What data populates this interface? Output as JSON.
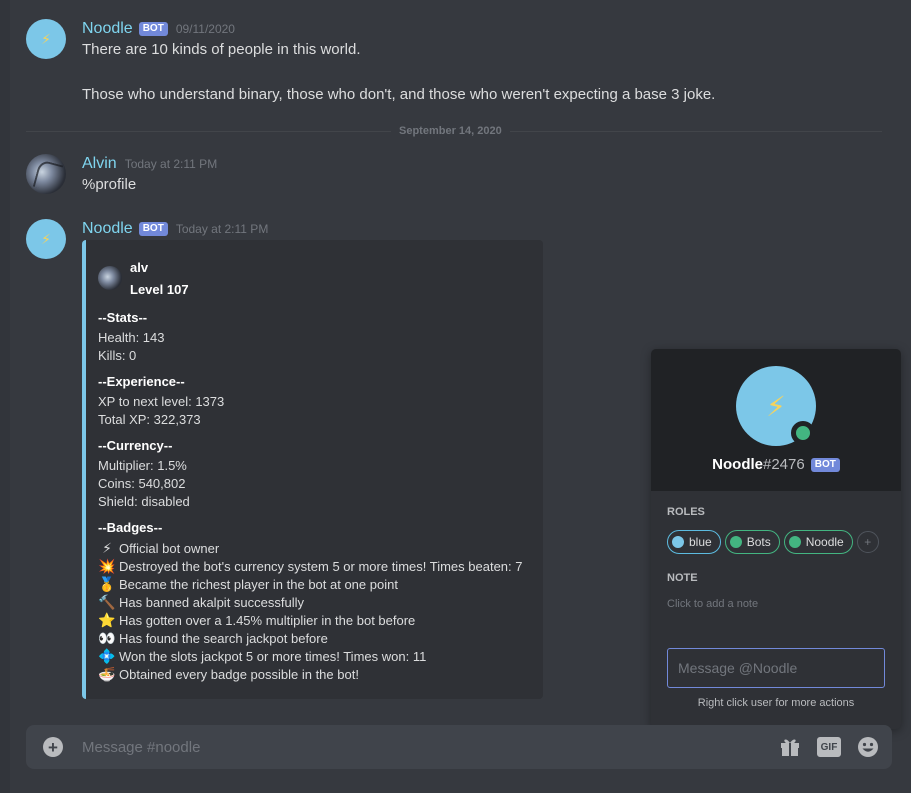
{
  "messages": [
    {
      "author": "Noodle",
      "bot_tag": "BOT",
      "timestamp": "09/11/2020",
      "line1": "There are 10 kinds of people in this world.",
      "line2": "Those who understand binary, those who don't, and those who weren't expecting a base 3 joke."
    },
    {
      "author": "Alvin",
      "timestamp": "Today at 2:11 PM",
      "text": "%profile"
    },
    {
      "author": "Noodle",
      "bot_tag": "BOT",
      "timestamp": "Today at 2:11 PM"
    }
  ],
  "divider": "September 14, 2020",
  "embed": {
    "name": "alv",
    "level": "Level 107",
    "stats_title": "--Stats--",
    "health": "Health: 143",
    "kills": "Kills: 0",
    "experience_title": "--Experience--",
    "xp_next": "XP to next level: 1373",
    "xp_total": "Total XP: 322,373",
    "currency_title": "--Currency--",
    "multiplier": "Multiplier: 1.5%",
    "coins": "Coins: 540,802",
    "shield": "Shield: disabled",
    "badges_title": "--Badges--",
    "badges": [
      {
        "icon": "lightning-icon",
        "glyph": "⚡",
        "text": "Official bot owner"
      },
      {
        "icon": "collision-icon",
        "glyph": "💥",
        "text": "Destroyed the bot's currency system 5 or more times! Times beaten: 7"
      },
      {
        "icon": "medal-icon",
        "glyph": "🥇",
        "text": "Became the richest player in the bot at one point"
      },
      {
        "icon": "hammer-icon",
        "glyph": "🔨",
        "text": "Has banned akalpit successfully"
      },
      {
        "icon": "star-icon",
        "glyph": "⭐",
        "text": "Has gotten over a 1.45% multiplier in the bot before"
      },
      {
        "icon": "eyes-icon",
        "glyph": "👀",
        "text": "Has found the search jackpot before"
      },
      {
        "icon": "diamond-icon",
        "glyph": "💠",
        "text": "Won the slots jackpot 5 or more times! Times won: 11"
      },
      {
        "icon": "noodle-bowl-icon",
        "glyph": "🍜",
        "text": "Obtained every badge possible in the bot!"
      }
    ]
  },
  "popout": {
    "name": "Noodle",
    "discriminator": "#2476",
    "bot_tag": "BOT",
    "roles_title": "ROLES",
    "roles": [
      {
        "label": "blue",
        "color": "#7cc7e8"
      },
      {
        "label": "Bots",
        "color": "#43b581"
      },
      {
        "label": "Noodle",
        "color": "#43b581"
      }
    ],
    "add_role": "+",
    "note_title": "NOTE",
    "note_placeholder": "Click to add a note",
    "message_placeholder": "Message @Noodle",
    "hint": "Right click user for more actions",
    "status_color": "#43b581"
  },
  "composer": {
    "placeholder": "Message #noodle",
    "gif_label": "GIF"
  },
  "colors": {
    "background": "#36393f",
    "bot_name": "#7fd5ef",
    "bot_tag": "#7289da",
    "embed_accent": "#7cc7e8"
  }
}
